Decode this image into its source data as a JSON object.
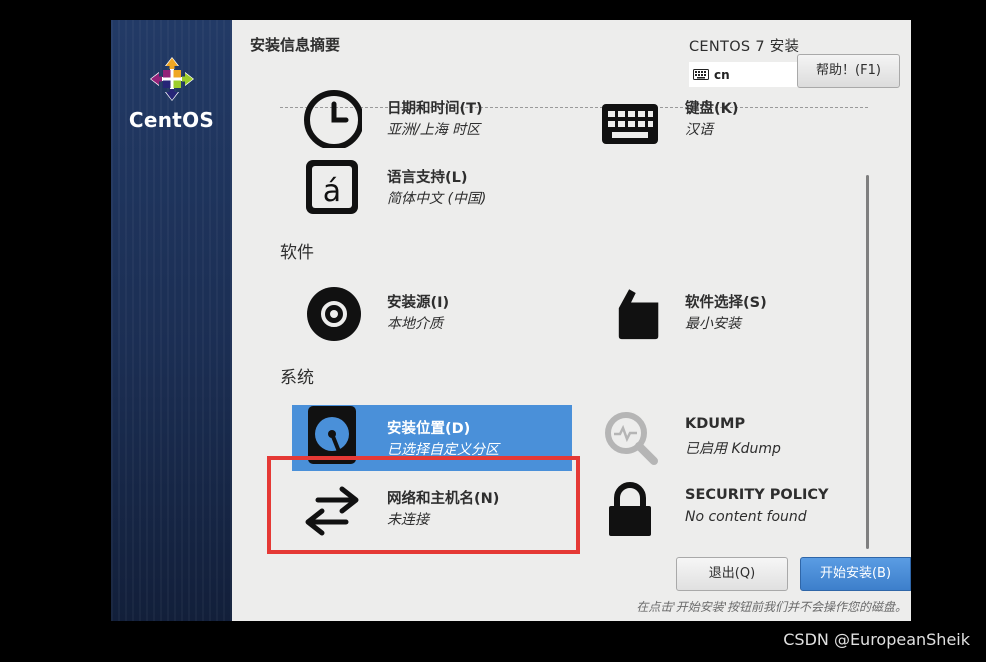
{
  "sidebar": {
    "logo_text": "CentOS"
  },
  "header": {
    "page_title": "安装信息摘要",
    "product_title": "CENTOS 7 安装",
    "keyboard_layout": "cn",
    "help_button": "帮助！(F1)"
  },
  "localization": {
    "datetime": {
      "label": "日期和时间(T)",
      "status": "亚洲/上海 时区",
      "icon": "clock-icon"
    },
    "keyboard": {
      "label": "键盘(K)",
      "status": "汉语",
      "icon": "keyboard-icon"
    },
    "language": {
      "label": "语言支持(L)",
      "status": "简体中文 (中国)",
      "icon": "language-icon"
    }
  },
  "software": {
    "title": "软件",
    "source": {
      "label": "安装源(I)",
      "status": "本地介质",
      "icon": "disc-icon"
    },
    "selection": {
      "label": "软件选择(S)",
      "status": "最小安装",
      "icon": "package-icon"
    }
  },
  "system": {
    "title": "系统",
    "destination": {
      "label": "安装位置(D)",
      "status": "已选择自定义分区",
      "icon": "harddisk-icon"
    },
    "kdump": {
      "label": "KDUMP",
      "status": "已启用 Kdump",
      "icon": "magnifier-icon"
    },
    "network": {
      "label": "网络和主机名(N)",
      "status": "未连接",
      "icon": "network-arrows-icon"
    },
    "security": {
      "label": "SECURITY POLICY",
      "status": "No content found",
      "icon": "lock-icon"
    }
  },
  "footer": {
    "quit_button": "退出(Q)",
    "begin_button": "开始安装(B)",
    "note": "在点击'开始安装'按钮前我们并不会操作您的磁盘。"
  },
  "watermark": "CSDN @EuropeanSheik",
  "colors": {
    "selected_spoke": "#4a90d9",
    "primary_button": "#4a8fd9",
    "highlight_box": "#e53935",
    "sidebar": "#1f355f"
  }
}
